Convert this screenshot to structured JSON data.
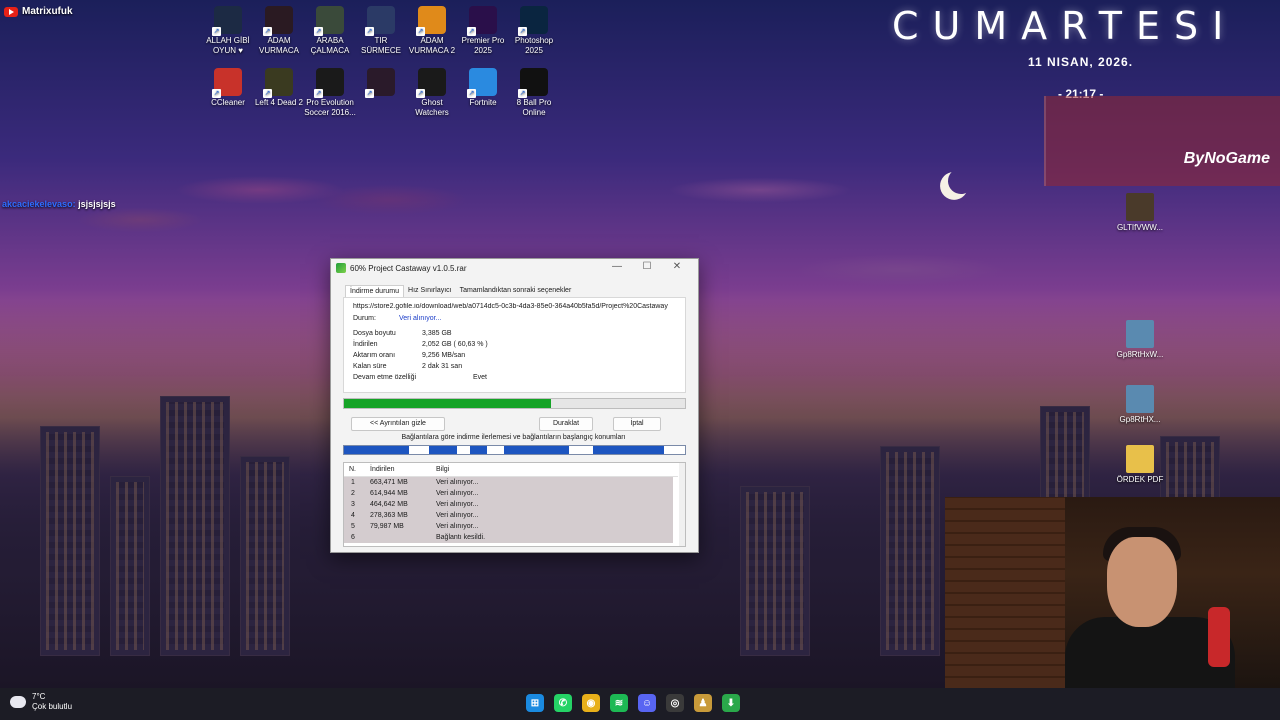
{
  "overlay": {
    "channel": "Matrixufuk",
    "chat_user": "akcaciekelevaso:",
    "chat_message": "jsjsjsjsjs",
    "day_name": "CUMARTESI",
    "date": "11 NISAN, 2026.",
    "time": "- 21:17 -",
    "promo_text": "ByNoGame"
  },
  "desktop": {
    "icons_row1": [
      {
        "label": "ALLAH GİBİ OYUN ♥",
        "color": "#1c2a44"
      },
      {
        "label": "ADAM VURMACA",
        "color": "#2a1a22"
      },
      {
        "label": "ARABA ÇALMACA",
        "color": "#3a4a3a"
      },
      {
        "label": "TIR SÜRMECE",
        "color": "#2b3a66"
      },
      {
        "label": "ADAM VURMACA 2",
        "color": "#e08a1a"
      },
      {
        "label": "Premier Pro 2025",
        "color": "#2a0f4a"
      },
      {
        "label": "Photoshop 2025",
        "color": "#0a2540"
      }
    ],
    "icons_row2": [
      {
        "label": "CCleaner",
        "color": "#c8322a"
      },
      {
        "label": "Left 4 Dead 2",
        "color": "#3a3a20"
      },
      {
        "label": "Pro Evolution Soccer 2016...",
        "color": "#1a1a1a"
      },
      {
        "label": "",
        "color": "#2a1a2a"
      },
      {
        "label": "Ghost Watchers",
        "color": "#1a1a1a"
      },
      {
        "label": "Fortnite",
        "color": "#2a8ae0"
      },
      {
        "label": "8 Ball Pro Online",
        "color": "#111111"
      }
    ],
    "right_icons": [
      {
        "label": "GLTIfVWW...",
        "color": "#4a3a2a"
      },
      {
        "label": "Gp8RtHxW...",
        "color": "#5a8ab0"
      },
      {
        "label": "Gp8RtHX...",
        "color": "#5a8ab0"
      },
      {
        "label": "ÖRDEK PDF",
        "color": "#e8c04a"
      }
    ]
  },
  "taskbar": {
    "temp": "7°C",
    "weather": "Çok bulutlu",
    "apps": [
      {
        "name": "windows-start-icon",
        "glyph": "⊞",
        "color": "#1a8ae0"
      },
      {
        "name": "whatsapp-icon",
        "glyph": "✆",
        "color": "#25d366"
      },
      {
        "name": "chrome-icon",
        "glyph": "◉",
        "color": "#e8b01a"
      },
      {
        "name": "spotify-icon",
        "glyph": "≋",
        "color": "#1db954"
      },
      {
        "name": "discord-icon",
        "glyph": "☺",
        "color": "#5865f2"
      },
      {
        "name": "obs-icon",
        "glyph": "◎",
        "color": "#3a3a3a"
      },
      {
        "name": "game-icon",
        "glyph": "♟",
        "color": "#c89a3a"
      },
      {
        "name": "idm-icon",
        "glyph": "⬇",
        "color": "#2aa84a"
      }
    ]
  },
  "idm": {
    "title": "60% Project Castaway v1.0.5.rar",
    "tabs": [
      "İndirme durumu",
      "Hız Sınırlayıcı",
      "Tamamlandıktan sonraki seçenekler"
    ],
    "url": "https://store2.gofile.io/download/web/a0714dc5-0c3b-4da3-85e0-364a40b5fa5d/Project%20Castaway",
    "status_label": "Durum:",
    "status_value": "Veri alınıyor...",
    "rows": [
      {
        "label": "Dosya boyutu",
        "value": "3,385 GB"
      },
      {
        "label": "İndirilen",
        "value": "2,052 GB ( 60,63 % )"
      },
      {
        "label": "Aktarım oranı",
        "value": "9,256 MB/san"
      },
      {
        "label": "Kalan süre",
        "value": "2 dak 31 san"
      },
      {
        "label": "Devam etme özelliği",
        "value": "Evet"
      }
    ],
    "progress": 0.6063,
    "btn_details": "<< Ayrıntıları gizle",
    "btn_pause": "Duraklat",
    "btn_cancel": "İptal",
    "conn_label": "Bağlantılara göre indirme ilerlemesi ve bağlantıların başlangıç konumları",
    "table_headers": [
      "N.",
      "İndirilen",
      "Bilgi"
    ],
    "connections": [
      {
        "n": "1",
        "downloaded": "663,471 MB",
        "info": "Veri alınıyor..."
      },
      {
        "n": "2",
        "downloaded": "614,944 MB",
        "info": "Veri alınıyor..."
      },
      {
        "n": "3",
        "downloaded": "464,642 MB",
        "info": "Veri alınıyor..."
      },
      {
        "n": "4",
        "downloaded": "278,363 MB",
        "info": "Veri alınıyor..."
      },
      {
        "n": "5",
        "downloaded": "79,987 MB",
        "info": "Veri alınıyor..."
      },
      {
        "n": "6",
        "downloaded": "",
        "info": "Bağlantı kesildi."
      }
    ]
  }
}
